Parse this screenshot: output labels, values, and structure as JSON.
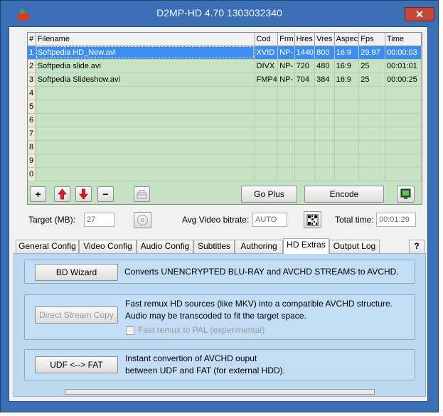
{
  "window": {
    "title": "D2MP-HD 4.70 1303032340",
    "close_glyph": "✕"
  },
  "table": {
    "headers": [
      "#",
      "Filename",
      "Cod",
      "Frm",
      "Hres",
      "Vres",
      "Aspect",
      "Fps",
      "Time"
    ],
    "rows": [
      [
        "1",
        "Softpedia HD_New.avi",
        "XVID",
        "NP-",
        "1440",
        "800",
        "16:9",
        "29.97",
        "00:00:03"
      ],
      [
        "2",
        "Softpedia slide.avi",
        "DIVX",
        "NP-",
        "720",
        "480",
        "16:9",
        "25",
        "00:01:01"
      ],
      [
        "3",
        "Softpedia Slideshow.avi",
        "FMP4",
        "NP-",
        "704",
        "384",
        "16:9",
        "25",
        "00:00:25"
      ],
      [
        "4",
        "",
        "",
        "",
        "",
        "",
        "",
        "",
        ""
      ],
      [
        "5",
        "",
        "",
        "",
        "",
        "",
        "",
        "",
        ""
      ],
      [
        "6",
        "",
        "",
        "",
        "",
        "",
        "",
        "",
        ""
      ],
      [
        "7",
        "",
        "",
        "",
        "",
        "",
        "",
        "",
        ""
      ],
      [
        "8",
        "",
        "",
        "",
        "",
        "",
        "",
        "",
        ""
      ],
      [
        "9",
        "",
        "",
        "",
        "",
        "",
        "",
        "",
        ""
      ],
      [
        "0",
        "",
        "",
        "",
        "",
        "",
        "",
        "",
        ""
      ]
    ]
  },
  "toolbar": {
    "add_glyph": "+",
    "remove_glyph": "−",
    "go_plus_label": "Go Plus",
    "encode_label": "Encode"
  },
  "settings": {
    "target_label": "Target (MB):",
    "target_value": "27",
    "bitrate_label": "Avg Video bitrate:",
    "bitrate_value": "AUTO",
    "total_time_label": "Total time:",
    "total_time_value": "00:01:29"
  },
  "tabs": [
    {
      "label": "General Config"
    },
    {
      "label": "Video Config"
    },
    {
      "label": "Audio Config"
    },
    {
      "label": "Subtitles"
    },
    {
      "label": "Authoring"
    },
    {
      "label": "HD Extras"
    },
    {
      "label": "Output Log"
    },
    {
      "label": "?"
    }
  ],
  "hd_extras": {
    "bd_wizard_label": "BD Wizard",
    "bd_wizard_desc": "Converts UNENCRYPTED BLU-RAY and AVCHD STREAMS to AVCHD.",
    "direct_stream_label": "Direct Stream Copy",
    "direct_stream_desc_1": "Fast remux HD sources (like MKV) into a compatible AVCHD structure.",
    "direct_stream_desc_2": "Audio may be transcoded to fit the target space.",
    "pal_checkbox_label": "Fast remux to PAL (experimental)",
    "udf_fat_label": "UDF <--> FAT",
    "udf_fat_desc_1": "Instant convertion of AVCHD ouput",
    "udf_fat_desc_2": "between UDF and FAT (for external HDD)."
  },
  "colors": {
    "grid_bg": "#c5e3c2",
    "selection": "#3d8ef0",
    "panel_bg": "#bdd9f1",
    "frame": "#3b6fb5"
  }
}
